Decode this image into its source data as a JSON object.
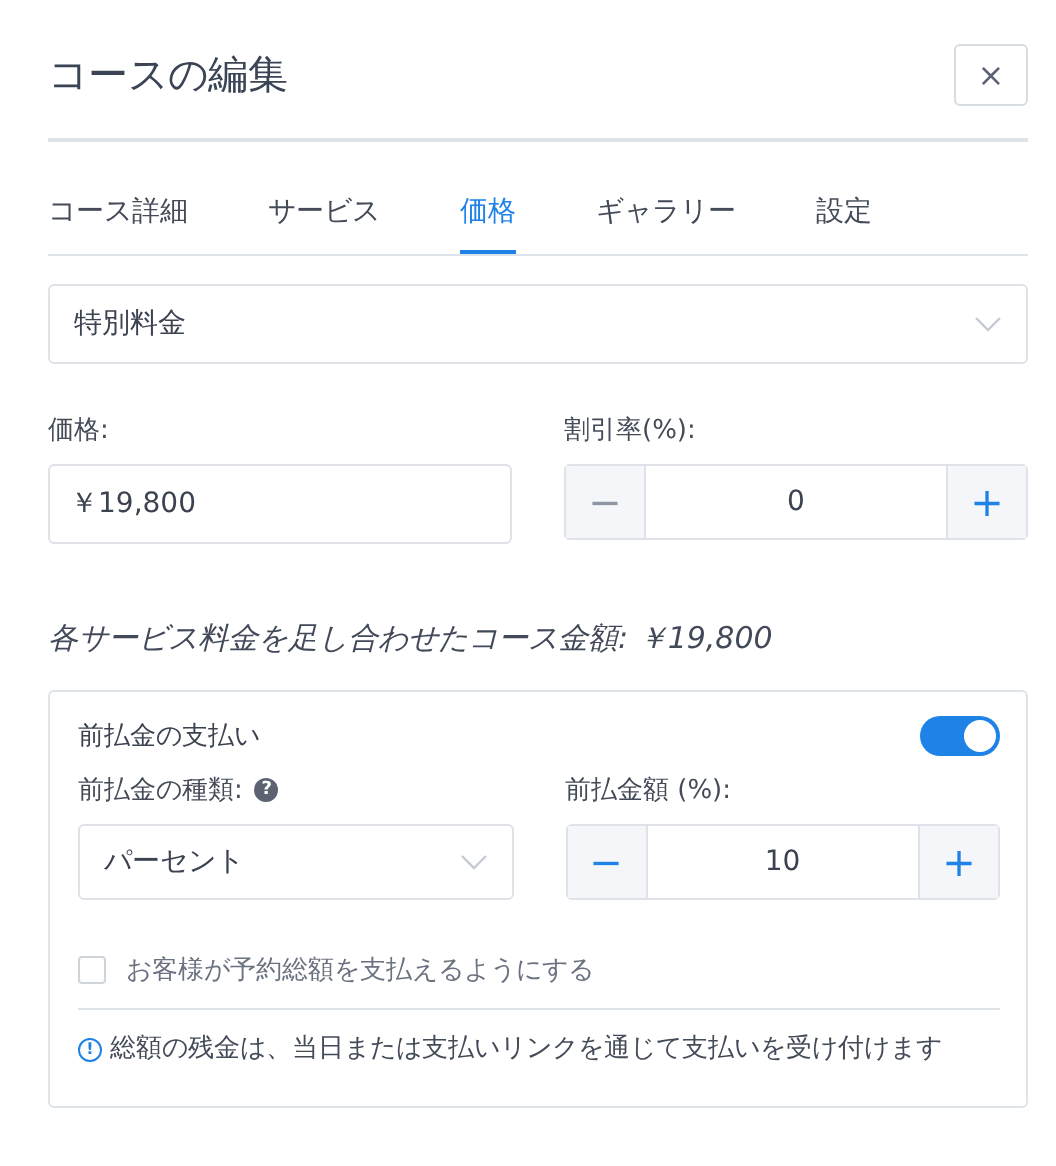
{
  "title": "コースの編集",
  "close": "×",
  "tabs": [
    {
      "label": "コース詳細",
      "selected": false
    },
    {
      "label": "サービス",
      "selected": false
    },
    {
      "label": "価格",
      "selected": true
    },
    {
      "label": "ギャラリー",
      "selected": false
    },
    {
      "label": "設定",
      "selected": false
    }
  ],
  "pricing_type": {
    "value": "特別料金"
  },
  "price": {
    "label": "価格:",
    "value": "￥19,800"
  },
  "discount": {
    "label": "割引率(%):",
    "value": "0",
    "minus": {
      "label": "−",
      "disabled": true
    },
    "plus": {
      "label": "+",
      "disabled": false
    }
  },
  "total_note": "各サービス料金を足し合わせたコース金額: ￥19,800",
  "deposit": {
    "title": "前払金の支払い",
    "on": true,
    "type": {
      "label": "前払金の種類:",
      "help": "?",
      "value": "パーセント"
    },
    "amount": {
      "label": "前払金額 (%):",
      "value": "10",
      "minus": {
        "label": "−",
        "disabled": false
      },
      "plus": {
        "label": "+",
        "disabled": false
      }
    },
    "full_payment": {
      "label": "お客様が予約総額を支払えるようにする",
      "checked": false
    },
    "info": {
      "icon": "!",
      "text": "総額の残金は、当日または支払いリンクを通じて支払いを受け付けます"
    }
  }
}
